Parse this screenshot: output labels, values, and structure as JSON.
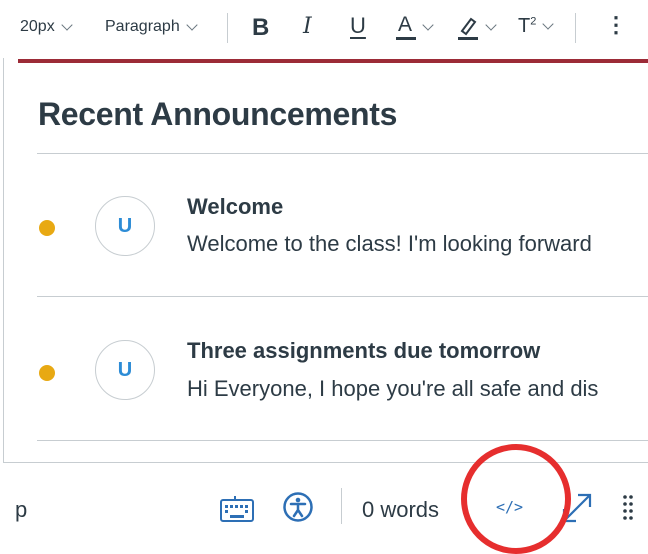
{
  "toolbar": {
    "font_size": "20px",
    "block_format": "Paragraph",
    "bold_label": "B",
    "italic_label": "I",
    "underline_label": "U",
    "text_color_label": "A",
    "superscript_label": "T",
    "superscript_mark": "2",
    "more_label": "⋮",
    "icons": [
      "bold-icon",
      "italic-icon",
      "underline-icon",
      "text-color-icon",
      "highlight-icon",
      "superscript-icon",
      "more-icon"
    ]
  },
  "editor": {
    "accent_color": "#9c2b37",
    "heading": "Recent Announcements",
    "announcements": [
      {
        "avatar": "U",
        "title": "Welcome",
        "body": "Welcome to the class! I'm looking forward"
      },
      {
        "avatar": "U",
        "title": "Three assignments due tomorrow",
        "body": "Hi Everyone, I hope you're all safe and dis"
      }
    ],
    "unread_dot_color": "#e8a913"
  },
  "status_bar": {
    "path": "p",
    "word_count": "0 words",
    "html_toggle": "</>",
    "icons": [
      "keyboard-icon",
      "accessibility-icon",
      "code-icon",
      "fullscreen-icon",
      "resize-grip-icon"
    ],
    "highlight_color": "#e62e2e"
  }
}
